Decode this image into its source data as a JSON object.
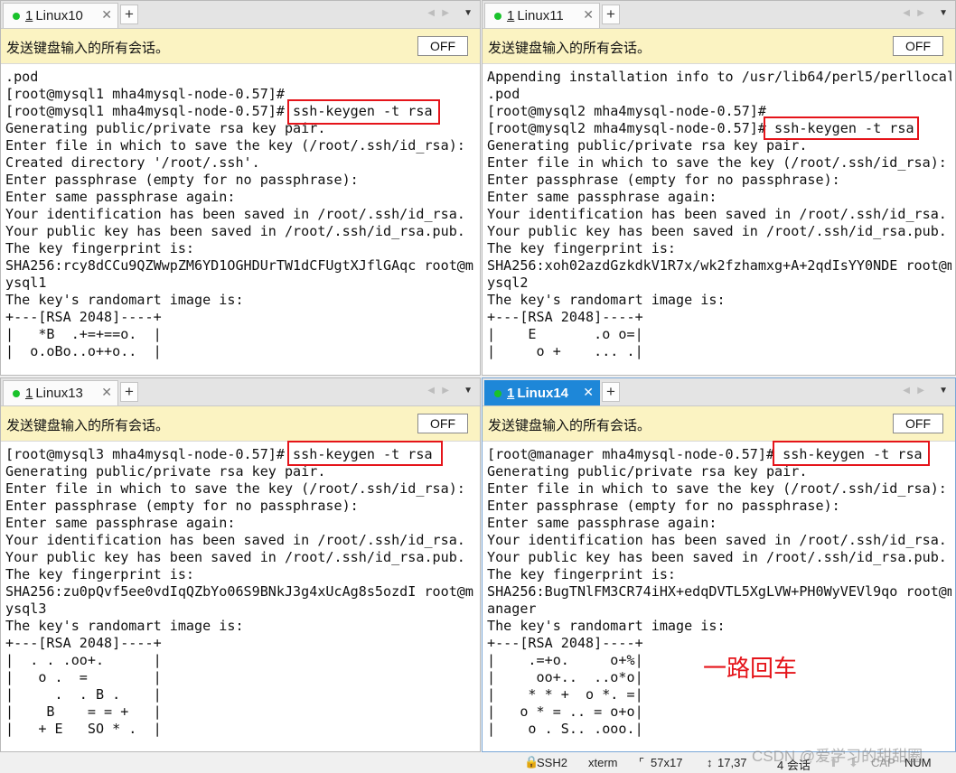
{
  "panes": [
    {
      "tab_num": "1",
      "tab_name": "Linux10",
      "broadcast_label": "发送键盘输入的所有会话。",
      "off_label": "OFF",
      "lines": [
        ".pod",
        "[root@mysql1 mha4mysql-node-0.57]#",
        "[root@mysql1 mha4mysql-node-0.57]# ssh-keygen -t rsa",
        "Generating public/private rsa key pair.",
        "Enter file in which to save the key (/root/.ssh/id_rsa):",
        "Created directory '/root/.ssh'.",
        "Enter passphrase (empty for no passphrase):",
        "Enter same passphrase again:",
        "Your identification has been saved in /root/.ssh/id_rsa.",
        "Your public key has been saved in /root/.ssh/id_rsa.pub.",
        "The key fingerprint is:",
        "SHA256:rcy8dCCu9QZWwpZM6YD1OGHDUrTW1dCFUgtXJflGAqc root@m",
        "ysql1",
        "The key's randomart image is:",
        "+---[RSA 2048]----+",
        "|   *B  .+=+==o.  |",
        "|  o.oBo..o++o..  |"
      ]
    },
    {
      "tab_num": "1",
      "tab_name": "Linux11",
      "broadcast_label": "发送键盘输入的所有会话。",
      "off_label": "OFF",
      "lines": [
        "Appending installation info to /usr/lib64/perl5/perllocal",
        ".pod",
        "[root@mysql2 mha4mysql-node-0.57]#",
        "[root@mysql2 mha4mysql-node-0.57]# ssh-keygen -t rsa",
        "Generating public/private rsa key pair.",
        "Enter file in which to save the key (/root/.ssh/id_rsa):",
        "Enter passphrase (empty for no passphrase):",
        "Enter same passphrase again:",
        "Your identification has been saved in /root/.ssh/id_rsa.",
        "Your public key has been saved in /root/.ssh/id_rsa.pub.",
        "The key fingerprint is:",
        "SHA256:xoh02azdGzkdkV1R7x/wk2fzhamxg+A+2qdIsYY0NDE root@m",
        "ysql2",
        "The key's randomart image is:",
        "+---[RSA 2048]----+",
        "|    E       .o o=|",
        "|     o +    ... .|"
      ]
    },
    {
      "tab_num": "1",
      "tab_name": "Linux13",
      "broadcast_label": "发送键盘输入的所有会话。",
      "off_label": "OFF",
      "lines": [
        "[root@mysql3 mha4mysql-node-0.57]# ssh-keygen -t rsa",
        "Generating public/private rsa key pair.",
        "Enter file in which to save the key (/root/.ssh/id_rsa):",
        "Enter passphrase (empty for no passphrase):",
        "Enter same passphrase again:",
        "Your identification has been saved in /root/.ssh/id_rsa.",
        "Your public key has been saved in /root/.ssh/id_rsa.pub.",
        "The key fingerprint is:",
        "SHA256:zu0pQvf5ee0vdIqQZbYo06S9BNkJ3g4xUcAg8s5ozdI root@m",
        "ysql3",
        "The key's randomart image is:",
        "+---[RSA 2048]----+",
        "|  . . .oo+.      |",
        "|   o .  =        |",
        "|     .  . B .    |",
        "|    B    = = +   |",
        "|   + E   SO * .  |"
      ]
    },
    {
      "tab_num": "1",
      "tab_name": "Linux14",
      "broadcast_label": "发送键盘输入的所有会话。",
      "off_label": "OFF",
      "lines": [
        "[root@manager mha4mysql-node-0.57]# ssh-keygen -t rsa",
        "Generating public/private rsa key pair.",
        "Enter file in which to save the key (/root/.ssh/id_rsa):",
        "Enter passphrase (empty for no passphrase):",
        "Enter same passphrase again:",
        "Your identification has been saved in /root/.ssh/id_rsa.",
        "Your public key has been saved in /root/.ssh/id_rsa.pub.",
        "The key fingerprint is:",
        "SHA256:BugTNlFM3CR74iHX+edqDVTL5XgLVW+PH0WyVEVl9qo root@m",
        "anager",
        "The key's randomart image is:",
        "+---[RSA 2048]----+",
        "|    .=+o.     o+%|",
        "|     oo+..  ..o*o|",
        "|    * * +  o *. =|",
        "|   o * = .. = o+o|",
        "|    o . S.. .ooo.|"
      ]
    }
  ],
  "annotation": "一路回车",
  "status": {
    "protocol": "SSH2",
    "terminal": "xterm",
    "size": "57x17",
    "cursor": "17,37",
    "sessions": "4 会话",
    "caps": "CAP",
    "num": "NUM"
  },
  "watermark": "CSDN @爱学习的甜甜圈",
  "colors": {
    "highlight_box": "#e5141a",
    "broadcast_bar": "#fbf3c2",
    "active_tab": "#1e87d8",
    "session_dot": "#19c22b"
  },
  "icons": {
    "tab_status": "green-dot-icon",
    "tab_close": "close-icon",
    "new_tab": "plus-icon",
    "nav_left": "triangle-left-icon",
    "nav_right": "triangle-right-icon",
    "tab_menu": "triangle-down-icon"
  }
}
